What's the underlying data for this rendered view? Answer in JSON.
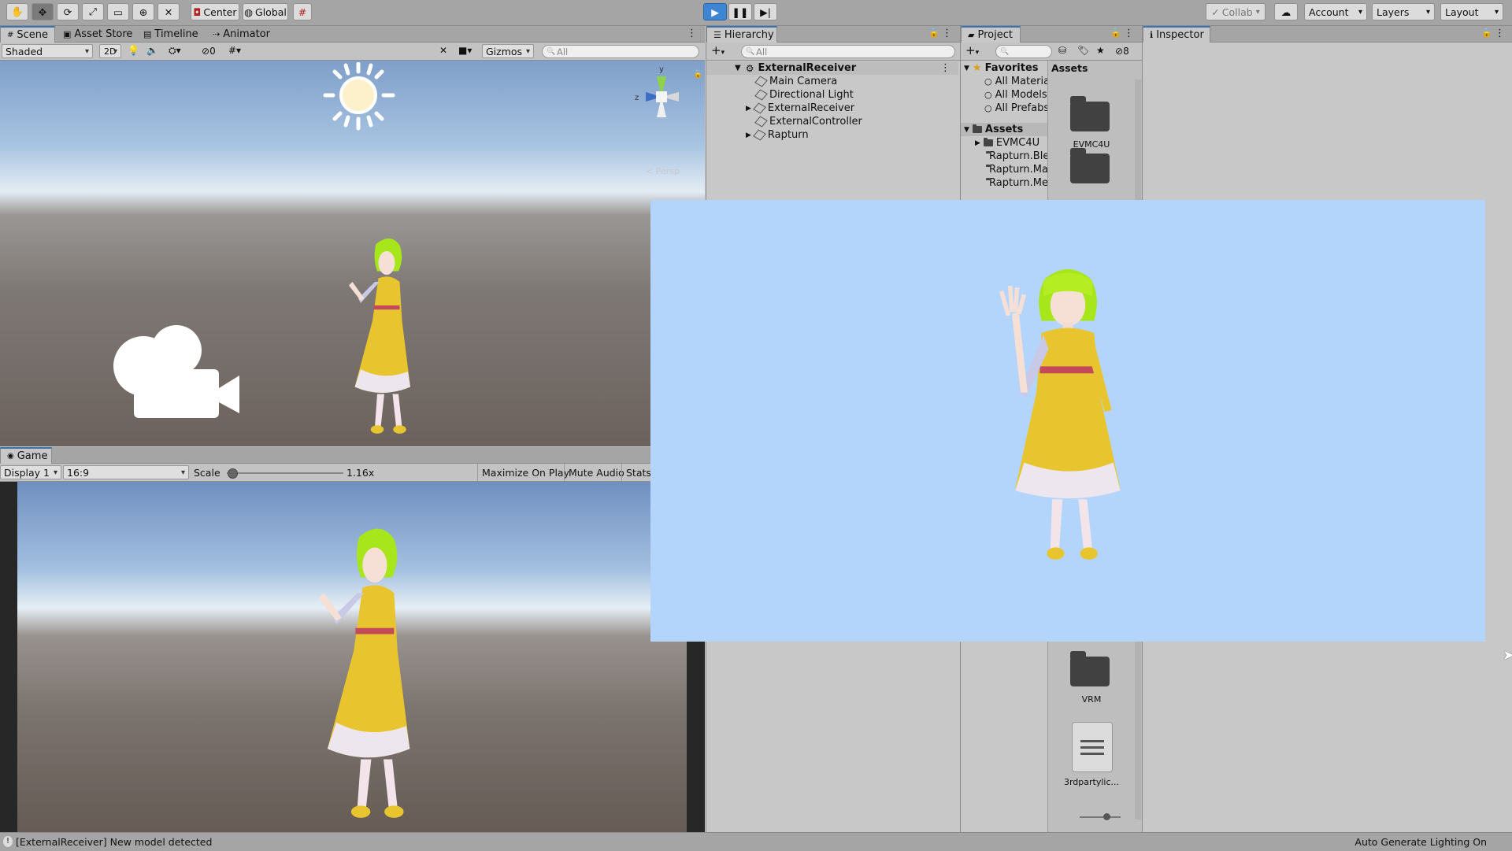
{
  "toolbar": {
    "pivot_label": "Center",
    "space_label": "Global",
    "collab_label": "Collab",
    "account_label": "Account",
    "layers_label": "Layers",
    "layout_label": "Layout"
  },
  "scene": {
    "tabs": [
      "Scene",
      "Asset Store",
      "Timeline",
      "Animator"
    ],
    "shading_mode": "Shaded",
    "mode_2d_label": "2D",
    "hidden_count": "0",
    "gizmos_label": "Gizmos",
    "search_placeholder": "All",
    "axis_y": "y",
    "axis_z": "z",
    "persp_label": "< Persp"
  },
  "game": {
    "tab_label": "Game",
    "display": "Display 1",
    "aspect": "16:9",
    "scale_label": "Scale",
    "scale_value": "1.16x",
    "scale_fraction": 0.05,
    "maximize_label": "Maximize On Play",
    "mute_label": "Mute Audio",
    "stats_label": "Stats"
  },
  "hierarchy": {
    "tab_label": "Hierarchy",
    "search_placeholder": "All",
    "root": "ExternalReceiver",
    "items": [
      {
        "label": "Main Camera",
        "expandable": false
      },
      {
        "label": "Directional Light",
        "expandable": false
      },
      {
        "label": "ExternalReceiver",
        "expandable": true
      },
      {
        "label": "ExternalController",
        "expandable": false
      },
      {
        "label": "Rapturn",
        "expandable": true
      }
    ]
  },
  "project": {
    "tab_label": "Project",
    "visible_count": "8",
    "favorites_label": "Favorites",
    "favorites": [
      "All Materia",
      "All Models",
      "All Prefabs"
    ],
    "assets_label": "Assets",
    "asset_folders": [
      "EVMC4U",
      "Rapturn.Ble",
      "Rapturn.Ma",
      "Rapturn.Me"
    ],
    "grid_header": "Assets",
    "grid_items": [
      {
        "label": "EVMC4U",
        "icon": "folder-icon"
      },
      {
        "label": "VRM",
        "icon": "folder-icon"
      },
      {
        "label": "3rdpartylic...",
        "icon": "document-icon"
      }
    ]
  },
  "inspector": {
    "tab_label": "Inspector"
  },
  "status": {
    "message": "[ExternalReceiver] New model detected",
    "right_text": "Auto Generate Lighting On"
  },
  "colors": {
    "play_blue": "#3e86d4",
    "overlay_sky": "#b3d5fc",
    "dress_yellow": "#e8c52e",
    "hair_green": "#a6e61a"
  }
}
